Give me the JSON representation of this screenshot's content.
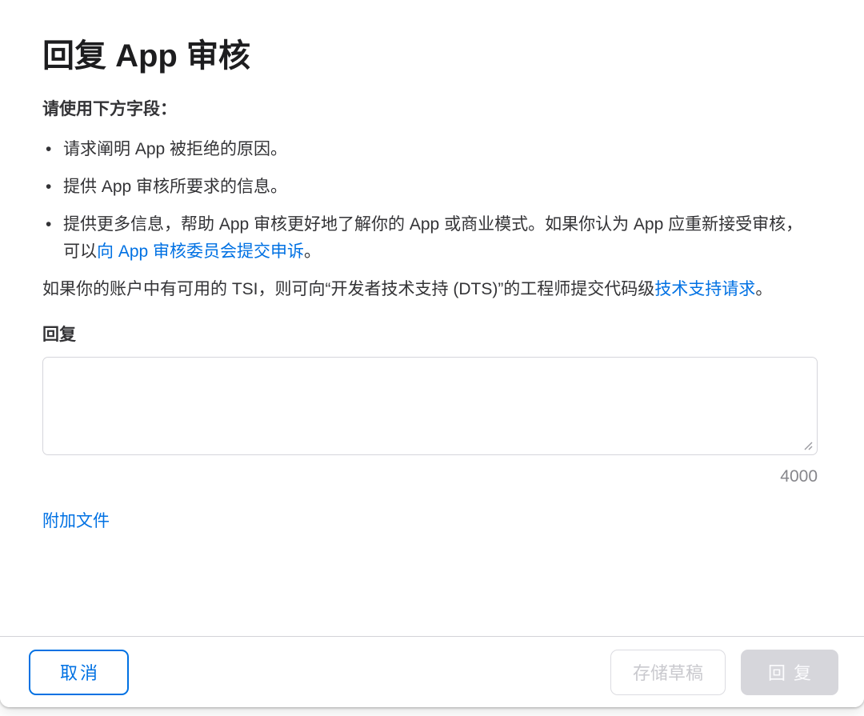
{
  "dialog": {
    "title": "回复 App 审核",
    "intro": "请使用下方字段：",
    "bullets": [
      {
        "text": "请求阐明 App 被拒绝的原因。"
      },
      {
        "text": "提供 App 审核所要求的信息。"
      },
      {
        "pre": "提供更多信息，帮助 App 审核更好地了解你的 App 或商业模式。如果你认为 App 应重新接受审核，可以",
        "link": "向 App 审核委员会提交申诉",
        "post": "。"
      }
    ],
    "tsi_paragraph": {
      "pre": "如果你的账户中有可用的 TSI，则可向“开发者技术支持 (DTS)”的工程师提交代码级",
      "link": "技术支持请求",
      "post": "。"
    },
    "reply_field": {
      "label": "回复",
      "value": "",
      "char_counter": "4000"
    },
    "attach_files_link": "附加文件",
    "footer": {
      "cancel_label": "取消",
      "save_draft_label": "存储草稿",
      "reply_label": "回复"
    }
  },
  "icons": {
    "textarea_resize": "resize-grip-icon"
  },
  "colors": {
    "link_blue": "#0071e3",
    "title_text": "#1d1d1f",
    "body_text": "#333336",
    "counter_gray": "#86868b",
    "divider_gray": "#d2d2d7",
    "disabled_fill": "#d6d6db",
    "disabled_text": "#c9c9ce"
  }
}
